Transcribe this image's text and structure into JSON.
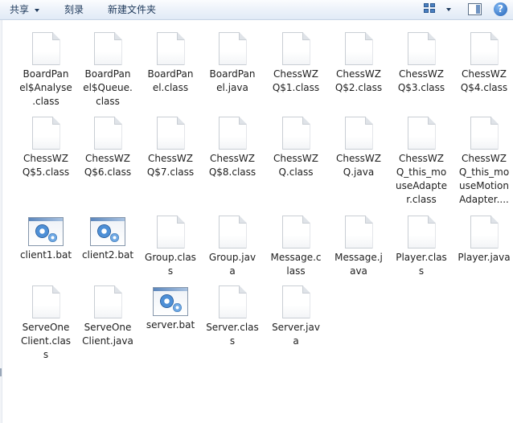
{
  "toolbar": {
    "share_label": "共享",
    "burn_label": "刻录",
    "new_folder_label": "新建文件夹",
    "help_glyph": "?"
  },
  "files": [
    {
      "name": "BoardPanel$Analyse.class",
      "label_lines": [
        "BoardPan",
        "el$Analyse",
        ".class"
      ],
      "icon": "file-icon"
    },
    {
      "name": "BoardPanel$Queue.class",
      "label_lines": [
        "BoardPan",
        "el$Queue.",
        "class"
      ],
      "icon": "file-icon"
    },
    {
      "name": "BoardPanel.class",
      "label_lines": [
        "BoardPan",
        "el.class"
      ],
      "icon": "file-icon"
    },
    {
      "name": "BoardPanel.java",
      "label_lines": [
        "BoardPan",
        "el.java"
      ],
      "icon": "file-icon"
    },
    {
      "name": "ChessWZQ$1.class",
      "label_lines": [
        "ChessWZ",
        "Q$1.class"
      ],
      "icon": "file-icon"
    },
    {
      "name": "ChessWZQ$2.class",
      "label_lines": [
        "ChessWZ",
        "Q$2.class"
      ],
      "icon": "file-icon"
    },
    {
      "name": "ChessWZQ$3.class",
      "label_lines": [
        "ChessWZ",
        "Q$3.class"
      ],
      "icon": "file-icon"
    },
    {
      "name": "ChessWZQ$4.class",
      "label_lines": [
        "ChessWZ",
        "Q$4.class"
      ],
      "icon": "file-icon"
    },
    {
      "name": "ChessWZQ$5.class",
      "label_lines": [
        "ChessWZ",
        "Q$5.class"
      ],
      "icon": "file-icon"
    },
    {
      "name": "ChessWZQ$6.class",
      "label_lines": [
        "ChessWZ",
        "Q$6.class"
      ],
      "icon": "file-icon"
    },
    {
      "name": "ChessWZQ$7.class",
      "label_lines": [
        "ChessWZ",
        "Q$7.class"
      ],
      "icon": "file-icon"
    },
    {
      "name": "ChessWZQ$8.class",
      "label_lines": [
        "ChessWZ",
        "Q$8.class"
      ],
      "icon": "file-icon"
    },
    {
      "name": "ChessWZQ.class",
      "label_lines": [
        "ChessWZ",
        "Q.class"
      ],
      "icon": "file-icon"
    },
    {
      "name": "ChessWZQ.java",
      "label_lines": [
        "ChessWZ",
        "Q.java"
      ],
      "icon": "file-icon"
    },
    {
      "name": "ChessWZQ_this_mouseAdapter.class",
      "label_lines": [
        "ChessWZ",
        "Q_this_mo",
        "useAdapte",
        "r.class"
      ],
      "icon": "file-icon"
    },
    {
      "name": "ChessWZQ_this_mouseMotionAdapter....",
      "label_lines": [
        "ChessWZ",
        "Q_this_mo",
        "useMotion",
        "Adapter...."
      ],
      "icon": "file-icon"
    },
    {
      "name": "client1.bat",
      "label_lines": [
        "client1.bat"
      ],
      "icon": "bat-icon"
    },
    {
      "name": "client2.bat",
      "label_lines": [
        "client2.bat"
      ],
      "icon": "bat-icon"
    },
    {
      "name": "Group.class",
      "label_lines": [
        "Group.clas",
        "s"
      ],
      "icon": "file-icon"
    },
    {
      "name": "Group.java",
      "label_lines": [
        "Group.jav",
        "a"
      ],
      "icon": "file-icon"
    },
    {
      "name": "Message.class",
      "label_lines": [
        "Message.c",
        "lass"
      ],
      "icon": "file-icon"
    },
    {
      "name": "Message.java",
      "label_lines": [
        "Message.j",
        "ava"
      ],
      "icon": "file-icon"
    },
    {
      "name": "Player.class",
      "label_lines": [
        "Player.clas",
        "s"
      ],
      "icon": "file-icon"
    },
    {
      "name": "Player.java",
      "label_lines": [
        "Player.java"
      ],
      "icon": "file-icon"
    },
    {
      "name": "ServeOneClient.class",
      "label_lines": [
        "ServeOne",
        "Client.clas",
        "s"
      ],
      "icon": "file-icon"
    },
    {
      "name": "ServeOneClient.java",
      "label_lines": [
        "ServeOne",
        "Client.java"
      ],
      "icon": "file-icon"
    },
    {
      "name": "server.bat",
      "label_lines": [
        "server.bat"
      ],
      "icon": "bat-icon"
    },
    {
      "name": "Server.class",
      "label_lines": [
        "Server.clas",
        "s"
      ],
      "icon": "file-icon"
    },
    {
      "name": "Server.java",
      "label_lines": [
        "Server.jav",
        "a"
      ],
      "icon": "file-icon"
    }
  ]
}
